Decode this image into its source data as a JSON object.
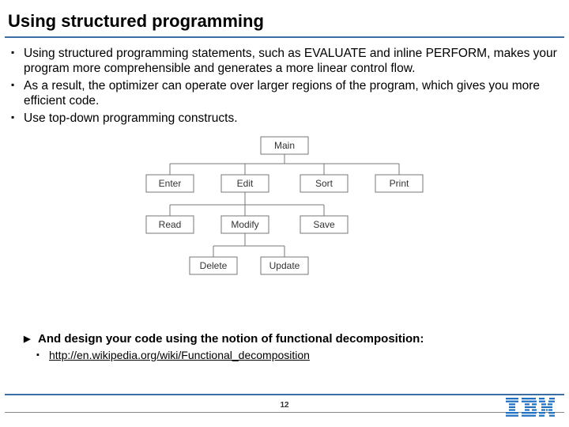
{
  "title": "Using structured programming",
  "bullets": [
    "Using structured programming statements, such as EVALUATE and inline PERFORM, makes your program more comprehensible and generates a more linear control flow.",
    "As a result, the optimizer can operate over larger regions of the program, which gives you more efficient code.",
    "Use top-down programming constructs."
  ],
  "diagram": {
    "nodes": {
      "root": {
        "label": "Main"
      },
      "c1": {
        "label": "Enter"
      },
      "c2": {
        "label": "Edit"
      },
      "c3": {
        "label": "Sort"
      },
      "c4": {
        "label": "Print"
      },
      "g1": {
        "label": "Read"
      },
      "g2": {
        "label": "Modify"
      },
      "g3": {
        "label": "Save"
      },
      "leaf1": {
        "label": "Delete"
      },
      "leaf2": {
        "label": "Update"
      }
    }
  },
  "closing_line": "And design your code using the notion of functional decomposition:",
  "link_text": "http://en.wikipedia.org/wiki/Functional_decomposition",
  "page_number": "12",
  "logo_text": "IBM"
}
